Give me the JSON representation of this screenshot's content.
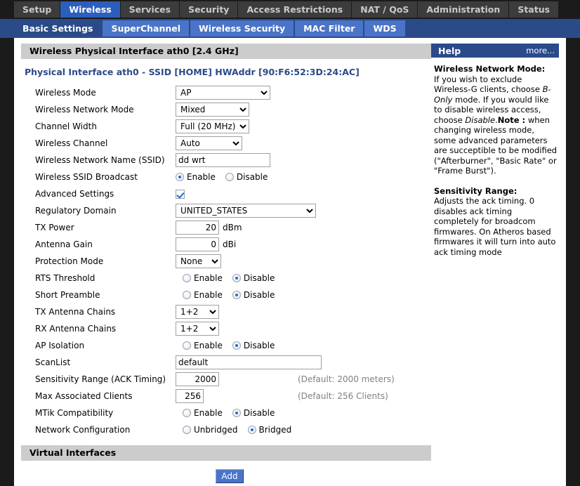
{
  "mainnav": {
    "tabs": [
      {
        "label": "Setup",
        "active": false
      },
      {
        "label": "Wireless",
        "active": true
      },
      {
        "label": "Services",
        "active": false
      },
      {
        "label": "Security",
        "active": false
      },
      {
        "label": "Access Restrictions",
        "active": false
      },
      {
        "label": "NAT / QoS",
        "active": false
      },
      {
        "label": "Administration",
        "active": false
      },
      {
        "label": "Status",
        "active": false
      }
    ]
  },
  "subnav": {
    "tabs": [
      {
        "label": "Basic Settings",
        "active": true
      },
      {
        "label": "SuperChannel",
        "active": false
      },
      {
        "label": "Wireless Security",
        "active": false
      },
      {
        "label": "MAC Filter",
        "active": false
      },
      {
        "label": "WDS",
        "active": false
      }
    ]
  },
  "section": {
    "title": "Wireless Physical Interface ath0 [2.4 GHz]",
    "interface_line": "Physical Interface ath0 - SSID [HOME] HWAddr [90:F6:52:3D:24:AC]"
  },
  "form": {
    "wireless_mode": {
      "label": "Wireless Mode",
      "value": "AP"
    },
    "wireless_network_mode": {
      "label": "Wireless Network Mode",
      "value": "Mixed"
    },
    "channel_width": {
      "label": "Channel Width",
      "value": "Full (20 MHz)"
    },
    "wireless_channel": {
      "label": "Wireless Channel",
      "value": "Auto"
    },
    "ssid": {
      "label": "Wireless Network Name (SSID)",
      "value": "dd wrt"
    },
    "ssid_broadcast": {
      "label": "Wireless SSID Broadcast",
      "enable_label": "Enable",
      "disable_label": "Disable",
      "selected": "enable"
    },
    "advanced_settings": {
      "label": "Advanced Settings",
      "checked": true
    },
    "regulatory_domain": {
      "label": "Regulatory Domain",
      "value": "UNITED_STATES"
    },
    "tx_power": {
      "label": "TX Power",
      "value": "20",
      "unit": "dBm"
    },
    "antenna_gain": {
      "label": "Antenna Gain",
      "value": "0",
      "unit": "dBi"
    },
    "protection_mode": {
      "label": "Protection Mode",
      "value": "None"
    },
    "rts_threshold": {
      "label": "RTS Threshold",
      "enable_label": "Enable",
      "disable_label": "Disable",
      "selected": "disable"
    },
    "short_preamble": {
      "label": "Short Preamble",
      "enable_label": "Enable",
      "disable_label": "Disable",
      "selected": "disable"
    },
    "tx_antenna_chains": {
      "label": "TX Antenna Chains",
      "value": "1+2"
    },
    "rx_antenna_chains": {
      "label": "RX Antenna Chains",
      "value": "1+2"
    },
    "ap_isolation": {
      "label": "AP Isolation",
      "enable_label": "Enable",
      "disable_label": "Disable",
      "selected": "disable"
    },
    "scanlist": {
      "label": "ScanList",
      "value": "default"
    },
    "sensitivity_range": {
      "label": "Sensitivity Range (ACK Timing)",
      "value": "2000",
      "hint": "(Default: 2000 meters)"
    },
    "max_clients": {
      "label": "Max Associated Clients",
      "value": "256",
      "hint": "(Default: 256 Clients)"
    },
    "mtik_compatibility": {
      "label": "MTik Compatibility",
      "enable_label": "Enable",
      "disable_label": "Disable",
      "selected": "disable"
    },
    "network_configuration": {
      "label": "Network Configuration",
      "unbridged_label": "Unbridged",
      "bridged_label": "Bridged",
      "selected": "bridged"
    }
  },
  "virtual_interfaces": {
    "title": "Virtual Interfaces",
    "add_label": "Add"
  },
  "help": {
    "title": "Help",
    "more": "more...",
    "section1_heading": "Wireless Network Mode:",
    "section1_text_a": "If you wish to exclude Wireless-G clients, choose ",
    "section1_em1": "B-Only",
    "section1_text_b": " mode. If you would like to disable wireless access, choose ",
    "section1_em2": "Disable",
    "section1_text_c": ".",
    "note_label": "Note :",
    "note_text": " when changing wireless mode, some advanced parameters are succeptible to be modified (\"Afterburner\", \"Basic Rate\" or \"Frame Burst\").",
    "section2_heading": "Sensitivity Range:",
    "section2_text": "Adjusts the ack timing. 0 disables ack timing completely for broadcom firmwares. On Atheros based firmwares it will turn into auto ack timing mode"
  },
  "colors": {
    "accent_blue": "#2b4a8a",
    "tab_blue": "#4a74c8",
    "active_main_tab": "#2c5fbd",
    "section_gray": "#cccccc",
    "page_dark": "#1b1b1b"
  }
}
